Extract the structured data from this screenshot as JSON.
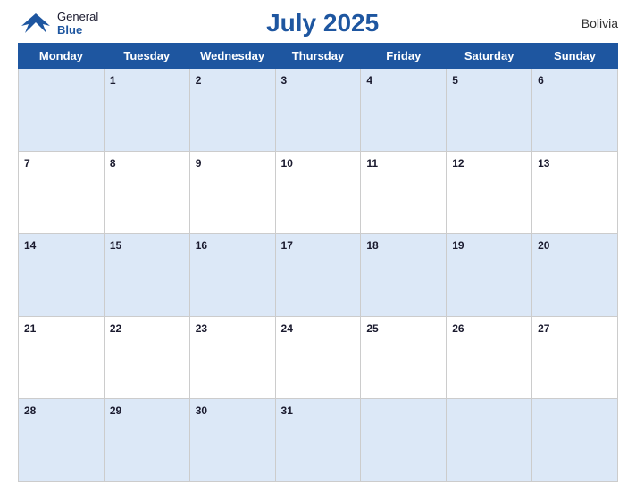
{
  "header": {
    "logo_general": "General",
    "logo_blue": "Blue",
    "title": "July 2025",
    "country": "Bolivia"
  },
  "weekdays": [
    "Monday",
    "Tuesday",
    "Wednesday",
    "Thursday",
    "Friday",
    "Saturday",
    "Sunday"
  ],
  "weeks": [
    [
      {
        "day": "",
        "empty": true
      },
      {
        "day": "1"
      },
      {
        "day": "2"
      },
      {
        "day": "3"
      },
      {
        "day": "4"
      },
      {
        "day": "5"
      },
      {
        "day": "6"
      }
    ],
    [
      {
        "day": "7"
      },
      {
        "day": "8"
      },
      {
        "day": "9"
      },
      {
        "day": "10"
      },
      {
        "day": "11"
      },
      {
        "day": "12"
      },
      {
        "day": "13"
      }
    ],
    [
      {
        "day": "14"
      },
      {
        "day": "15"
      },
      {
        "day": "16"
      },
      {
        "day": "17"
      },
      {
        "day": "18"
      },
      {
        "day": "19"
      },
      {
        "day": "20"
      }
    ],
    [
      {
        "day": "21"
      },
      {
        "day": "22"
      },
      {
        "day": "23"
      },
      {
        "day": "24"
      },
      {
        "day": "25"
      },
      {
        "day": "26"
      },
      {
        "day": "27"
      }
    ],
    [
      {
        "day": "28"
      },
      {
        "day": "29"
      },
      {
        "day": "30"
      },
      {
        "day": "31"
      },
      {
        "day": "",
        "empty": true
      },
      {
        "day": "",
        "empty": true
      },
      {
        "day": "",
        "empty": true
      }
    ]
  ]
}
